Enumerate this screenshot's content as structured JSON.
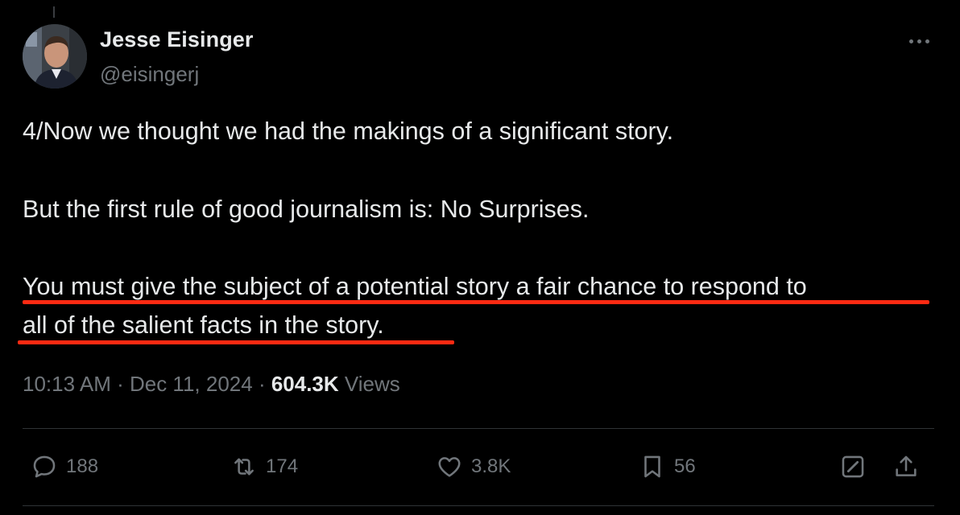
{
  "author": {
    "name": "Jesse Eisinger",
    "handle": "@eisingerj"
  },
  "tweet": {
    "line1": "4/Now we thought we had the makings of a significant story.",
    "line2": "But the first rule of good journalism is: No Surprises.",
    "line3a": "You must give the subject of a potential story a fair chance to respond to",
    "line3b": "all of the salient facts in the story.",
    "highlight_color": "#ff2a12"
  },
  "meta": {
    "time": "10:13 AM",
    "sep1": " · ",
    "date": "Dec 11, 2024",
    "sep2": " · ",
    "views_count": "604.3K",
    "views_label": " Views"
  },
  "actions": {
    "replies": "188",
    "reposts": "174",
    "likes": "3.8K",
    "bookmarks": "56"
  },
  "icons": [
    "more-icon",
    "reply-icon",
    "repost-icon",
    "like-icon",
    "bookmark-icon",
    "grok-icon",
    "share-icon"
  ]
}
